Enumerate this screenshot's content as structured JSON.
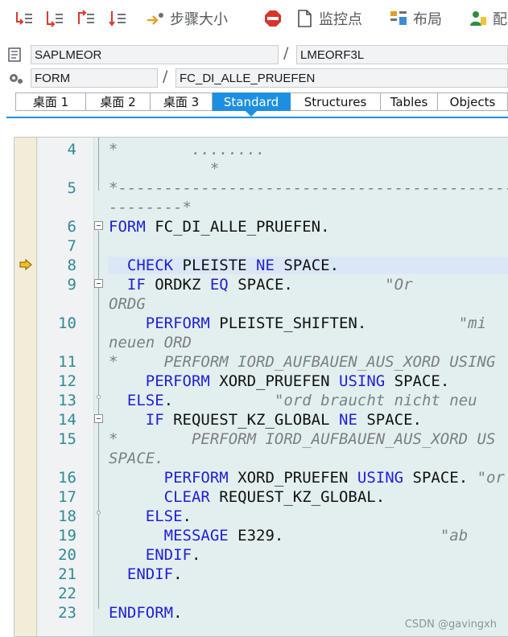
{
  "toolbar": {
    "step_size_label": "步骤大小",
    "watch_label": "监控点",
    "layout_label": "布局",
    "config_label": "配"
  },
  "program": {
    "main_program": "SAPLMEOR",
    "include": "LMEORF3L",
    "type": "FORM",
    "name": "FC_DI_ALLE_PRUEFEN"
  },
  "tabs": [
    {
      "label": "桌面 1"
    },
    {
      "label": "桌面 2"
    },
    {
      "label": "桌面 3"
    },
    {
      "label": "Standard"
    },
    {
      "label": "Structures"
    },
    {
      "label": "Tables"
    },
    {
      "label": "Objects"
    }
  ],
  "active_tab": "Standard",
  "code": {
    "line_numbers": [
      "4",
      "5",
      "6",
      "7",
      "8",
      "9",
      "10",
      "11",
      "12",
      "13",
      "14",
      "15",
      "16",
      "17",
      "18",
      "19",
      "20",
      "21",
      "22",
      "23"
    ],
    "current_line": "8",
    "lines": [
      {
        "n": "4",
        "parts": [
          [
            "cm",
            "*        ........"
          ]
        ]
      },
      {
        "n": "4b",
        "parts": [
          [
            "cm",
            "           *"
          ]
        ]
      },
      {
        "n": "5",
        "parts": [
          [
            "cm",
            "*----------------------------------------------"
          ]
        ]
      },
      {
        "n": "5b",
        "parts": [
          [
            "cm",
            "--------*"
          ]
        ]
      },
      {
        "n": "6",
        "parts": [
          [
            "kw",
            "FORM"
          ],
          [
            "tx",
            " FC_DI_ALLE_PRUEFEN."
          ]
        ]
      },
      {
        "n": "7",
        "parts": []
      },
      {
        "n": "8",
        "parts": [
          [
            "tx",
            "  "
          ],
          [
            "kw",
            "CHECK"
          ],
          [
            "tx",
            " PLEISTE "
          ],
          [
            "kw",
            "NE"
          ],
          [
            "tx",
            " SPACE."
          ]
        ]
      },
      {
        "n": "9",
        "parts": [
          [
            "tx",
            "  "
          ],
          [
            "kw",
            "IF"
          ],
          [
            "tx",
            " ORDKZ "
          ],
          [
            "kw",
            "EQ"
          ],
          [
            "tx",
            " SPACE.          "
          ],
          [
            "cm",
            "\"Or"
          ]
        ]
      },
      {
        "n": "9b",
        "parts": [
          [
            "cm",
            "ORDG"
          ]
        ]
      },
      {
        "n": "10",
        "parts": [
          [
            "tx",
            "    "
          ],
          [
            "kw",
            "PERFORM"
          ],
          [
            "tx",
            " PLEISTE_SHIFTEN.          "
          ],
          [
            "cm",
            "\"mi"
          ]
        ]
      },
      {
        "n": "10b",
        "parts": [
          [
            "cm",
            "neuen ORD"
          ]
        ]
      },
      {
        "n": "11",
        "parts": [
          [
            "cm",
            "*     PERFORM IORD_AUFBAUEN_AUS_XORD USING"
          ]
        ]
      },
      {
        "n": "12",
        "parts": [
          [
            "tx",
            "    "
          ],
          [
            "kw",
            "PERFORM"
          ],
          [
            "tx",
            " XORD_PRUEFEN "
          ],
          [
            "kw",
            "USING"
          ],
          [
            "tx",
            " SPACE."
          ]
        ]
      },
      {
        "n": "13",
        "parts": [
          [
            "tx",
            "  "
          ],
          [
            "kw",
            "ELSE"
          ],
          [
            "tx",
            ".           "
          ],
          [
            "cm",
            "\"ord braucht nicht neu"
          ]
        ]
      },
      {
        "n": "14",
        "parts": [
          [
            "tx",
            "    "
          ],
          [
            "kw",
            "IF"
          ],
          [
            "tx",
            " REQUEST_KZ_GLOBAL "
          ],
          [
            "kw",
            "NE"
          ],
          [
            "tx",
            " SPACE."
          ]
        ]
      },
      {
        "n": "15",
        "parts": [
          [
            "cm",
            "*        PERFORM IORD_AUFBAUEN_AUS_XORD US"
          ]
        ]
      },
      {
        "n": "15b",
        "parts": [
          [
            "cm",
            "SPACE."
          ]
        ]
      },
      {
        "n": "16",
        "parts": [
          [
            "tx",
            "      "
          ],
          [
            "kw",
            "PERFORM"
          ],
          [
            "tx",
            " XORD_PRUEFEN "
          ],
          [
            "kw",
            "USING"
          ],
          [
            "tx",
            " SPACE. "
          ],
          [
            "cm",
            "\"or"
          ]
        ]
      },
      {
        "n": "17",
        "parts": [
          [
            "tx",
            "      "
          ],
          [
            "kw",
            "CLEAR"
          ],
          [
            "tx",
            " REQUEST_KZ_GLOBAL."
          ]
        ]
      },
      {
        "n": "18",
        "parts": [
          [
            "tx",
            "    "
          ],
          [
            "kw",
            "ELSE"
          ],
          [
            "tx",
            "."
          ]
        ]
      },
      {
        "n": "19",
        "parts": [
          [
            "tx",
            "      "
          ],
          [
            "kw",
            "MESSAGE"
          ],
          [
            "tx",
            " E329.                 "
          ],
          [
            "cm",
            "\"ab"
          ]
        ]
      },
      {
        "n": "20",
        "parts": [
          [
            "tx",
            "    "
          ],
          [
            "kw",
            "ENDIF"
          ],
          [
            "tx",
            "."
          ]
        ]
      },
      {
        "n": "21",
        "parts": [
          [
            "tx",
            "  "
          ],
          [
            "kw",
            "ENDIF"
          ],
          [
            "tx",
            "."
          ]
        ]
      },
      {
        "n": "22",
        "parts": []
      },
      {
        "n": "23",
        "parts": [
          [
            "kw",
            "ENDFORM"
          ],
          [
            "tx",
            "."
          ]
        ]
      }
    ]
  },
  "watermark": "CSDN @gavingxh",
  "colors": {
    "keyword": "#1f1fd6",
    "comment": "#7a7f85",
    "line_number": "#2e8b96",
    "active_tab": "#1e8fe0",
    "editor_bg": "#e3efef"
  }
}
